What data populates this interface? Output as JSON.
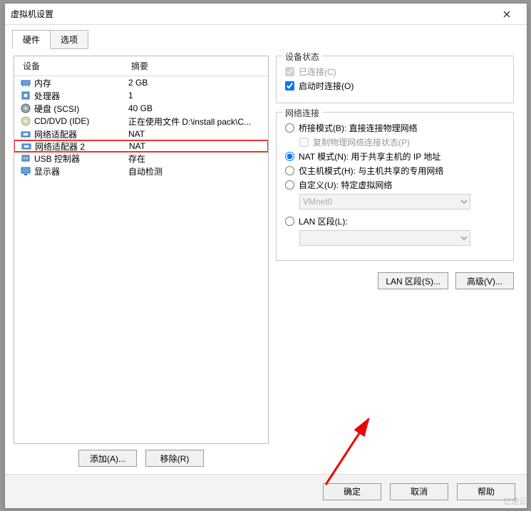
{
  "window": {
    "title": "虚拟机设置"
  },
  "tabs": {
    "hardware": "硬件",
    "options": "选项"
  },
  "headers": {
    "device": "设备",
    "summary": "摘要"
  },
  "devices": [
    {
      "icon": "memory-icon",
      "name": "内存",
      "summary": "2 GB"
    },
    {
      "icon": "cpu-icon",
      "name": "处理器",
      "summary": "1"
    },
    {
      "icon": "disk-icon",
      "name": "硬盘 (SCSI)",
      "summary": "40 GB"
    },
    {
      "icon": "cd-icon",
      "name": "CD/DVD (IDE)",
      "summary": "正在使用文件 D:\\install pack\\C..."
    },
    {
      "icon": "net-icon",
      "name": "网络适配器",
      "summary": "NAT"
    },
    {
      "icon": "net-icon",
      "name": "网络适配器 2",
      "summary": "NAT"
    },
    {
      "icon": "usb-icon",
      "name": "USB 控制器",
      "summary": "存在"
    },
    {
      "icon": "display-icon",
      "name": "显示器",
      "summary": "自动检测"
    }
  ],
  "buttons": {
    "add": "添加(A)...",
    "remove": "移除(R)",
    "lan_segments": "LAN 区段(S)...",
    "advanced": "高级(V)...",
    "ok": "确定",
    "cancel": "取消",
    "help": "帮助"
  },
  "statusbox": {
    "legend": "设备状态",
    "connected": "已连接(C)",
    "connect_on_power": "启动时连接(O)"
  },
  "netbox": {
    "legend": "网络连接",
    "bridged": "桥接模式(B): 直接连接物理网络",
    "replicate": "复制物理网络连接状态(P)",
    "nat": "NAT 模式(N): 用于共享主机的 IP 地址",
    "hostonly": "仅主机模式(H): 与主机共享的专用网络",
    "custom": "自定义(U): 特定虚拟网络",
    "lan_seg": "LAN 区段(L):",
    "vmnet_value": "VMnet0"
  },
  "watermark": "亿速云"
}
